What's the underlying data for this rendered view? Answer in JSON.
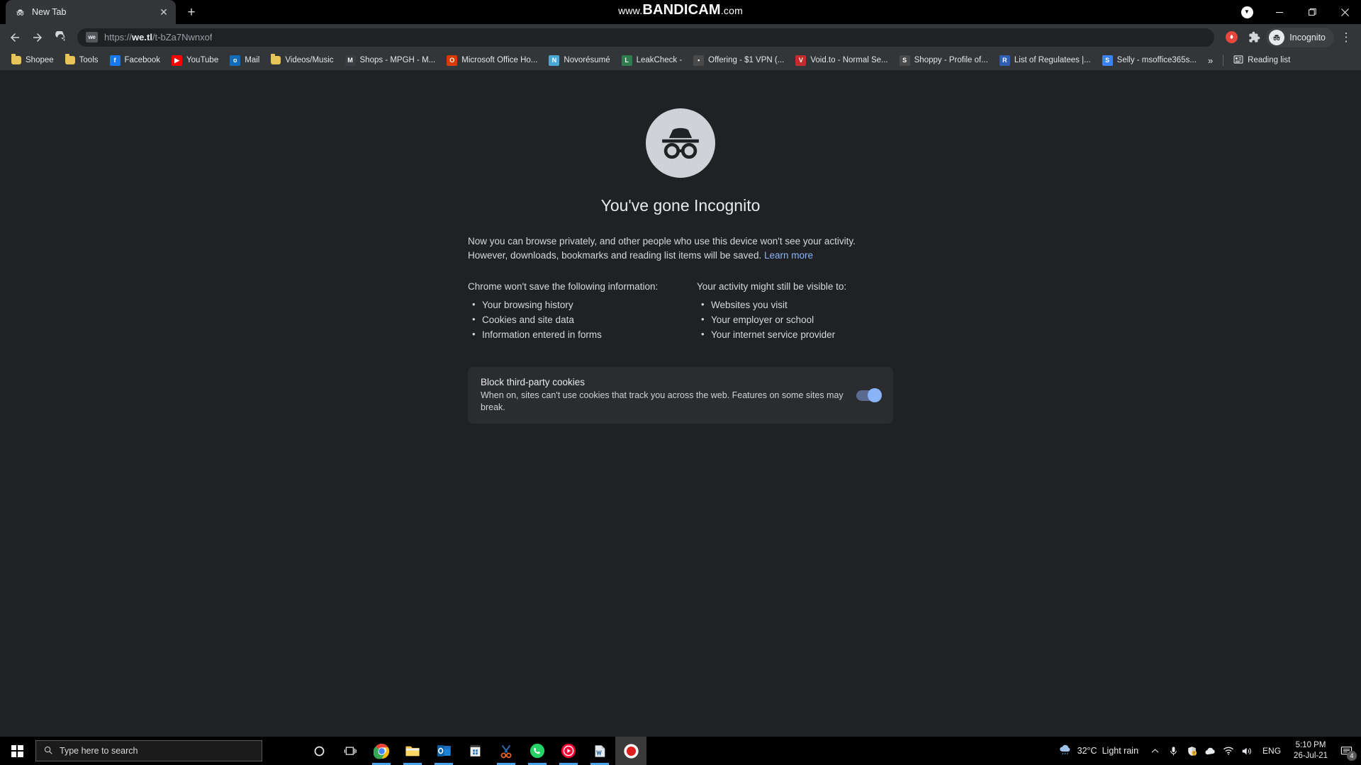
{
  "window": {
    "watermark_pre": "www.",
    "watermark_main": "BANDICAM",
    "watermark_post": ".com",
    "minimize_label": "–",
    "maximize_label": "❐",
    "close_label": "✕",
    "capture_icon": "bandicam-record-dot-icon"
  },
  "tab": {
    "title": "New Tab",
    "favicon": "incognito-icon",
    "close_label": "✕",
    "new_tab_label": "+"
  },
  "toolbar": {
    "back_label": "←",
    "forward_label": "→",
    "reload_label": "⟳",
    "site_badge": "we",
    "url_scheme": "https://",
    "url_host": "we.tl",
    "url_path": "/t-bZa7Nwnxof",
    "url_full": "https://we.tl/t-bZa7Nwnxof",
    "profile_label": "Incognito",
    "menu_label": "⋮",
    "extensions_icon": "puzzle-piece-icon",
    "adblock_icon": "red-extension-icon"
  },
  "bookmarks": {
    "items": [
      {
        "label": "Shopee",
        "icon": "folder-icon",
        "type": "folder"
      },
      {
        "label": "Tools",
        "icon": "folder-icon",
        "type": "folder"
      },
      {
        "label": "Facebook",
        "icon": "facebook-icon",
        "type": "site",
        "color": "#1877f2",
        "glyph": "f"
      },
      {
        "label": "YouTube",
        "icon": "youtube-icon",
        "type": "site",
        "color": "#ff0000",
        "glyph": "▶"
      },
      {
        "label": "Mail",
        "icon": "outlook-mail-icon",
        "type": "site",
        "color": "#0f6cbd",
        "glyph": "o"
      },
      {
        "label": "Videos/Music",
        "icon": "folder-icon",
        "type": "folder"
      },
      {
        "label": "Shops - MPGH - M...",
        "icon": "mpgh-icon",
        "type": "site",
        "color": "#3a3d41",
        "glyph": "M"
      },
      {
        "label": "Microsoft Office Ho...",
        "icon": "office-icon",
        "type": "site",
        "color": "#d83b01",
        "glyph": "O"
      },
      {
        "label": "Novorésumé",
        "icon": "novoresume-icon",
        "type": "site",
        "color": "#4aa8d8",
        "glyph": "N"
      },
      {
        "label": "LeakCheck -",
        "icon": "leakcheck-icon",
        "type": "site",
        "color": "#2f7d4f",
        "glyph": "L"
      },
      {
        "label": "Offering - $1 VPN (...",
        "icon": "vpn-icon",
        "type": "site",
        "color": "#4a4a4a",
        "glyph": "•"
      },
      {
        "label": "Void.to - Normal Se...",
        "icon": "void-icon",
        "type": "site",
        "color": "#c42b2b",
        "glyph": "V"
      },
      {
        "label": "Shoppy - Profile of...",
        "icon": "shoppy-icon",
        "type": "site",
        "color": "#4a4a4a",
        "glyph": "S"
      },
      {
        "label": "List of Regulatees |...",
        "icon": "regulatees-icon",
        "type": "site",
        "color": "#2f5fb4",
        "glyph": "R"
      },
      {
        "label": "Selly - msoffice365s...",
        "icon": "selly-icon",
        "type": "site",
        "color": "#3b82f6",
        "glyph": "S"
      }
    ],
    "overflow_label": "»",
    "reading_list_label": "Reading list",
    "reading_list_icon": "reading-list-icon"
  },
  "ntp": {
    "icon": "incognito-hat-glasses-icon",
    "heading": "You've gone Incognito",
    "intro_line1": "Now you can browse privately, and other people who use this device won't see your activity.",
    "intro_line2_pre": "However, downloads, bookmarks and reading list items will be saved. ",
    "learn_more": "Learn more",
    "columns": [
      {
        "heading": "Chrome won't save the following information:",
        "items": [
          "Your browsing history",
          "Cookies and site data",
          "Information entered in forms"
        ]
      },
      {
        "heading": "Your activity might still be visible to:",
        "items": [
          "Websites you visit",
          "Your employer or school",
          "Your internet service provider"
        ]
      }
    ],
    "cookie_card": {
      "title": "Block third-party cookies",
      "description": "When on, sites can't use cookies that track you across the web. Features on some sites may break.",
      "toggle_state": "on"
    }
  },
  "taskbar": {
    "start_icon": "windows-start-icon",
    "search_placeholder": "Type here to search",
    "search_icon": "magnifier-icon",
    "pinned": [
      {
        "name": "cortana-icon",
        "glyph": "◯"
      },
      {
        "name": "task-view-icon",
        "glyph": "▤"
      },
      {
        "name": "google-chrome-icon",
        "glyph": ""
      },
      {
        "name": "file-explorer-icon",
        "glyph": ""
      },
      {
        "name": "outlook-icon",
        "glyph": ""
      },
      {
        "name": "microsoft-store-icon",
        "glyph": ""
      },
      {
        "name": "snipping-tool-icon",
        "glyph": ""
      },
      {
        "name": "whatsapp-icon",
        "glyph": ""
      },
      {
        "name": "youtube-music-icon",
        "glyph": ""
      },
      {
        "name": "wps-office-icon",
        "glyph": ""
      },
      {
        "name": "bandicam-icon",
        "glyph": ""
      }
    ],
    "tray": {
      "weather_icon": "cloud-rain-icon",
      "temperature": "32°C",
      "condition": "Light rain",
      "chevron": "⌃",
      "icons": [
        "microphone-icon",
        "security-shield-icon",
        "onedrive-icon",
        "wifi-icon",
        "volume-icon"
      ],
      "language": "ENG",
      "time": "5:10 PM",
      "date": "26-Jul-21",
      "notification_icon": "notification-icon",
      "notification_count": "4"
    }
  }
}
